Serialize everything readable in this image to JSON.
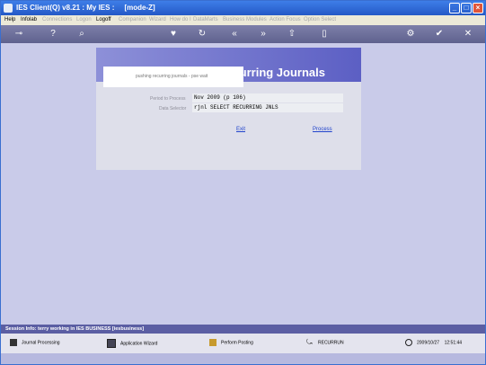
{
  "titlebar": {
    "title": "IES Client(Q) v8.21 : My IES :     [mode-Z]"
  },
  "menu": [
    {
      "label": "Help",
      "enabled": true
    },
    {
      "label": "Infolab",
      "enabled": true
    },
    {
      "label": "Connections",
      "enabled": false
    },
    {
      "label": "Logon",
      "enabled": false
    },
    {
      "label": "Logoff",
      "enabled": true
    },
    {
      "label": "Companion",
      "enabled": false
    },
    {
      "label": "Wizard",
      "enabled": false
    },
    {
      "label": "How do I",
      "enabled": false
    },
    {
      "label": "DataMarts",
      "enabled": false
    },
    {
      "label": "Business Modules",
      "enabled": false
    },
    {
      "label": "Action Focus",
      "enabled": false
    },
    {
      "label": "Option Select",
      "enabled": false
    }
  ],
  "panel": {
    "heading": "Recurring Journals",
    "popup_text": "pushing recurring journals - pse wait",
    "period_label": "Period to Process",
    "period_value": "Nov 2009 (p 106)",
    "selector_label": "Data Selector",
    "selector_value": "rjnl SELECT RECURRING JNLS",
    "exit_label": "Exit",
    "process_label": "Process"
  },
  "status": {
    "text": "Session Info: terry working in IES BUSINESS   [iesbusiness]"
  },
  "footer": {
    "items": [
      {
        "label": "Journal Processing",
        "icon": "book-icon"
      },
      {
        "label": "Application Wizard",
        "icon": "wizard-icon"
      },
      {
        "label": "Perform Posting",
        "icon": "posting-icon"
      },
      {
        "label": "RECURRUN",
        "icon": "recurrun-icon"
      }
    ],
    "date": "2009/10/27",
    "time": "12:51:44"
  }
}
